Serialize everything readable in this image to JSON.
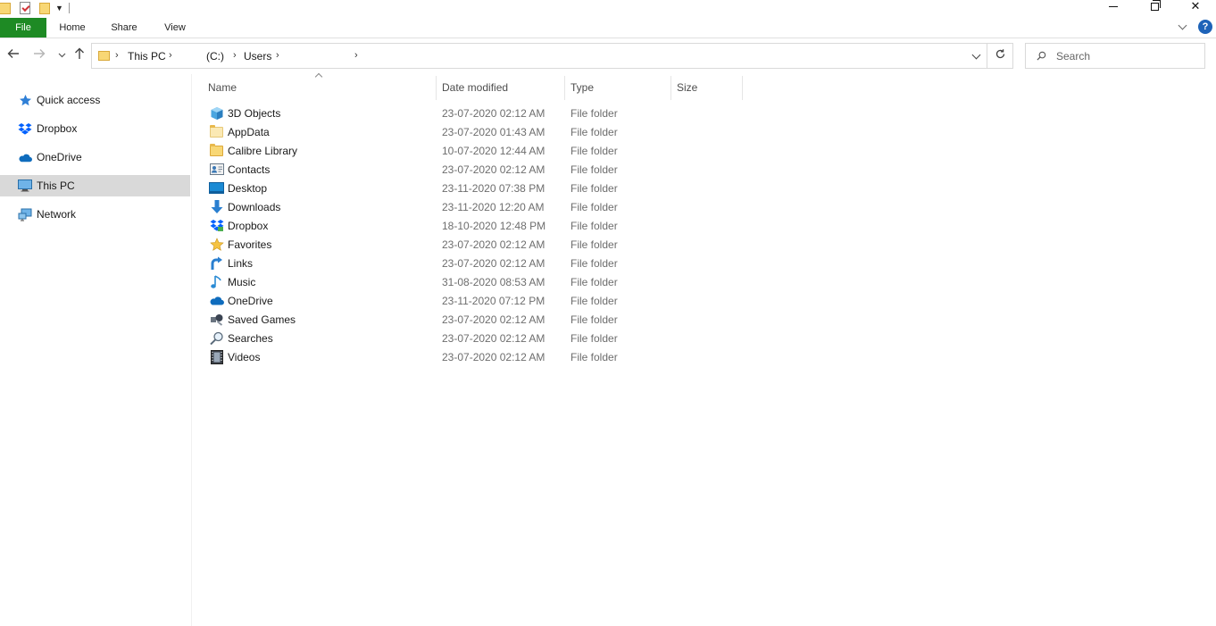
{
  "window": {
    "minimize_glyph": "—",
    "close_glyph": "✕"
  },
  "ribbon": {
    "tabs": [
      {
        "label": "File"
      },
      {
        "label": "Home"
      },
      {
        "label": "Share"
      },
      {
        "label": "View"
      }
    ],
    "help_label": "?"
  },
  "address": {
    "crumbs": [
      "This PC",
      "(C:)",
      "Users"
    ],
    "separator": "›"
  },
  "search": {
    "placeholder": "Search"
  },
  "navpane": {
    "items": [
      {
        "label": "Quick access",
        "icon": "star-icon"
      },
      {
        "label": "Dropbox",
        "icon": "dropbox-icon"
      },
      {
        "label": "OneDrive",
        "icon": "cloud-icon"
      },
      {
        "label": "This PC",
        "icon": "computer-icon",
        "selected": true
      },
      {
        "label": "Network",
        "icon": "network-icon"
      }
    ]
  },
  "columns": {
    "name": "Name",
    "date": "Date modified",
    "type": "Type",
    "size": "Size"
  },
  "files": [
    {
      "name": "3D Objects",
      "date": "23-07-2020 02:12 AM",
      "type": "File folder",
      "icon": "cube-icon"
    },
    {
      "name": "AppData",
      "date": "23-07-2020 01:43 AM",
      "type": "File folder",
      "icon": "folder-icon"
    },
    {
      "name": "Calibre Library",
      "date": "10-07-2020 12:44 AM",
      "type": "File folder",
      "icon": "folder-icon"
    },
    {
      "name": "Contacts",
      "date": "23-07-2020 02:12 AM",
      "type": "File folder",
      "icon": "contacts-icon"
    },
    {
      "name": "Desktop",
      "date": "23-11-2020 07:38 PM",
      "type": "File folder",
      "icon": "desktop-icon"
    },
    {
      "name": "Downloads",
      "date": "23-11-2020 12:20 AM",
      "type": "File folder",
      "icon": "download-icon"
    },
    {
      "name": "Dropbox",
      "date": "18-10-2020 12:48 PM",
      "type": "File folder",
      "icon": "dropbox-icon"
    },
    {
      "name": "Favorites",
      "date": "23-07-2020 02:12 AM",
      "type": "File folder",
      "icon": "star-icon"
    },
    {
      "name": "Links",
      "date": "23-07-2020 02:12 AM",
      "type": "File folder",
      "icon": "link-icon"
    },
    {
      "name": "Music",
      "date": "31-08-2020 08:53 AM",
      "type": "File folder",
      "icon": "music-icon"
    },
    {
      "name": "OneDrive",
      "date": "23-11-2020 07:12 PM",
      "type": "File folder",
      "icon": "cloud-icon"
    },
    {
      "name": "Saved Games",
      "date": "23-07-2020 02:12 AM",
      "type": "File folder",
      "icon": "games-icon"
    },
    {
      "name": "Searches",
      "date": "23-07-2020 02:12 AM",
      "type": "File folder",
      "icon": "search-icon"
    },
    {
      "name": "Videos",
      "date": "23-07-2020 02:12 AM",
      "type": "File folder",
      "icon": "video-icon"
    }
  ]
}
